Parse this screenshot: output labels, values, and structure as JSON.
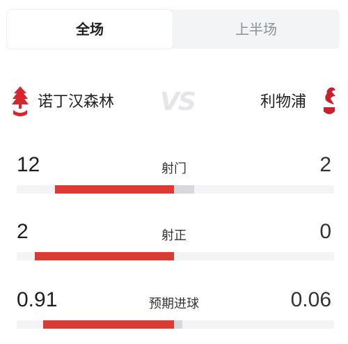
{
  "tabs": [
    {
      "label": "全场",
      "active": true
    },
    {
      "label": "上半场",
      "active": false
    }
  ],
  "match": {
    "home_team": "诺丁汉森林",
    "away_team": "利物浦",
    "vs_text": "VS",
    "home_crest_icon": "nottingham-forest-crest-icon",
    "away_crest_icon": "liverpool-crest-icon"
  },
  "colors": {
    "home_bar": "#db3b32",
    "away_bar": "#d7d8dc",
    "track": "#f4f4f6"
  },
  "stats": [
    {
      "label": "射门",
      "home": "12",
      "away": "2",
      "home_share": 0.857,
      "away_share": 0.143
    },
    {
      "label": "射正",
      "home": "2",
      "away": "0",
      "home_share": 1.0,
      "away_share": 0.0
    },
    {
      "label": "预期进球",
      "home": "0.91",
      "away": "0.06",
      "home_share": 0.938,
      "away_share": 0.062
    }
  ]
}
